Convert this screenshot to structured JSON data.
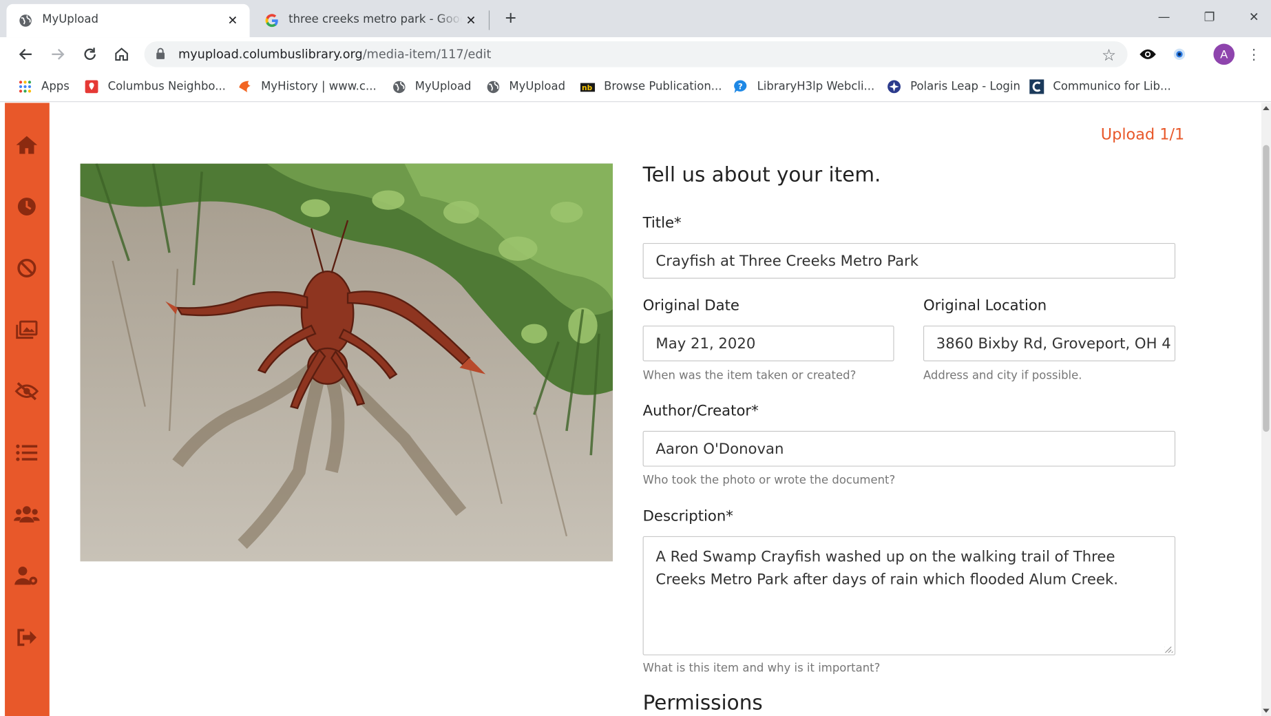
{
  "browser": {
    "tabs": [
      {
        "label": "MyUpload",
        "close": "✕"
      },
      {
        "label": "three creeks metro park - Google",
        "close": "✕"
      }
    ],
    "new_tab": "+",
    "window_controls": {
      "minimize": "—",
      "restore": "❐",
      "close": "✕"
    },
    "address": {
      "host": "myupload.columbuslibrary.org",
      "path": "/media-item/117/edit"
    },
    "profile_initial": "A",
    "bookmarks": [
      {
        "label": "Apps",
        "icon": "apps-grid-icon"
      },
      {
        "label": "Columbus Neighbo...",
        "icon": "map-pin-icon"
      },
      {
        "label": "MyHistory | www.c...",
        "icon": "myhistory-icon"
      },
      {
        "label": "MyUpload",
        "icon": "globe-icon"
      },
      {
        "label": "MyUpload",
        "icon": "globe-icon"
      },
      {
        "label": "Browse Publication...",
        "icon": "nb-icon"
      },
      {
        "label": "LibraryH3lp Webcli...",
        "icon": "help-icon"
      },
      {
        "label": "Polaris Leap - Login",
        "icon": "polaris-icon"
      },
      {
        "label": "Communico for Lib...",
        "icon": "communico-icon"
      }
    ]
  },
  "sidebar": {
    "color": "#e8582a",
    "items": [
      "home-icon",
      "clock-icon",
      "ban-icon",
      "gallery-icon",
      "hidden-icon",
      "list-icon",
      "users-icon",
      "user-settings-icon",
      "logout-icon"
    ]
  },
  "main": {
    "upload_count": "Upload 1/1",
    "heading": "Tell us about your item.",
    "title": {
      "label": "Title*",
      "value": "Crayfish at Three Creeks Metro Park"
    },
    "original_date": {
      "label": "Original Date",
      "value": "May 21, 2020",
      "help": "When was the item taken or created?"
    },
    "original_location": {
      "label": "Original Location",
      "value": "3860 Bixby Rd, Groveport, OH 4",
      "help": "Address and city if possible."
    },
    "author": {
      "label": "Author/Creator*",
      "value": "Aaron O'Donovan",
      "help": "Who took the photo or wrote the document?"
    },
    "description": {
      "label": "Description*",
      "value": "A Red Swamp Crayfish washed up on the walking trail of Three Creeks Metro Park after days of rain which flooded Alum Creek.",
      "help": "What is this item and why is it important?"
    },
    "permissions_heading": "Permissions"
  }
}
